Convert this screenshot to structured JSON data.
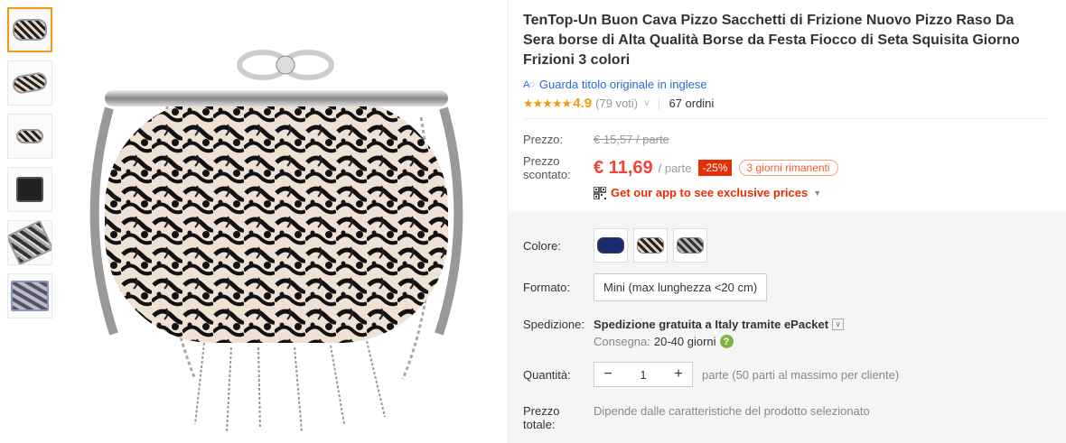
{
  "thumbnails": [
    "thumb-1",
    "thumb-2",
    "thumb-3",
    "thumb-4",
    "thumb-5",
    "thumb-6"
  ],
  "product": {
    "title": "TenTop-Un Buon Cava Pizzo Sacchetti di Frizione Nuovo Pizzo Raso Da Sera borse di Alta Qualità Borse da Festa Fiocco di Seta Squisita Giorno Frizioni 3 colori",
    "translate_link": "Guarda titolo originale in inglese",
    "stars": "★★★★★",
    "rating": "4.9",
    "votes": "(79 voti)",
    "orders": "67 ordini"
  },
  "price": {
    "label": "Prezzo:",
    "old_price": "€ 15,57 / parte",
    "discount_label": "Prezzo scontato:",
    "new_price": "€ 11,69",
    "per_unit": "/ parte",
    "discount_badge": "-25%",
    "days_left": "3 giorni rimanenti",
    "app_promo": "Get our app to see exclusive prices"
  },
  "options": {
    "color_label": "Colore:",
    "format_label": "Formato:",
    "format_value": "Mini (max lunghezza <20 cm)",
    "shipping_label": "Spedizione:",
    "shipping_value": "Spedizione gratuita a Italy tramite ePacket",
    "delivery_label": "Consegna:",
    "delivery_value": "20-40 giorni",
    "quantity_label": "Quantità:",
    "quantity_value": "1",
    "quantity_note": "parte (50 parti al massimo per cliente)",
    "total_label": "Prezzo totale:",
    "total_note": "Dipende dalle caratteristiche del prodotto selezionato"
  },
  "colors": {
    "accent": "#f39c12",
    "price_red": "#f44336",
    "link_blue": "#2a6ad5"
  }
}
